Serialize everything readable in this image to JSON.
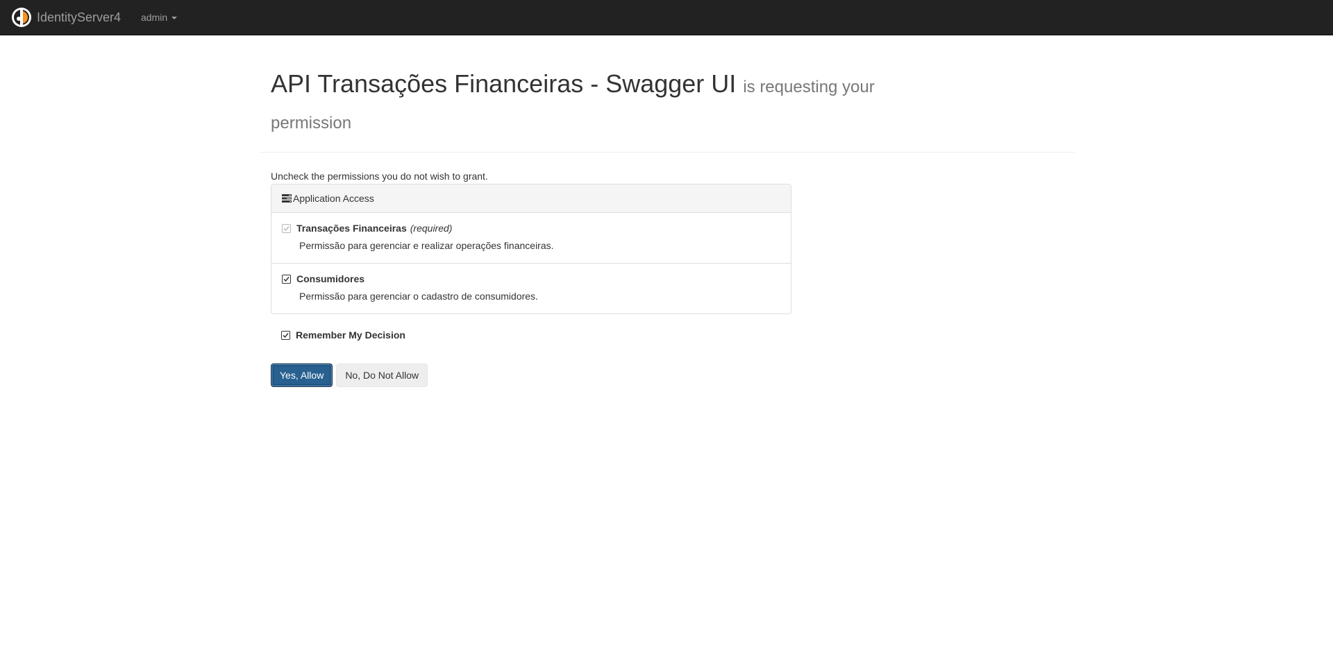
{
  "navbar": {
    "brand_name": "IdentityServer4",
    "user_label": "admin",
    "logo_icon": "identityserver-logo-icon",
    "dropdown_icon": "caret-down-icon"
  },
  "header": {
    "client_name": "API Transações Financeiras - Swagger UI",
    "request_text": "is requesting your permission"
  },
  "instruction": "Uncheck the permissions you do not wish to grant.",
  "panel": {
    "heading_icon": "tasks-icon",
    "heading": "Application Access",
    "scopes": [
      {
        "name": "Transações Financeiras",
        "required_label": "(required)",
        "description": "Permissão para gerenciar e realizar operações financeiras.",
        "checked": true,
        "disabled": true
      },
      {
        "name": "Consumidores",
        "required_label": "",
        "description": "Permissão para gerenciar o cadastro de consumidores.",
        "checked": true,
        "disabled": false
      }
    ]
  },
  "remember": {
    "label": "Remember My Decision",
    "checked": true
  },
  "buttons": {
    "allow": "Yes, Allow",
    "deny": "No, Do Not Allow"
  },
  "colors": {
    "navbar_bg": "#222222",
    "primary": "#286090",
    "brand_accent": "#f7931e"
  }
}
